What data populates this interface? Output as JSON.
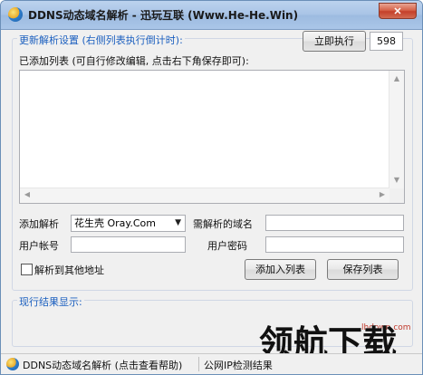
{
  "window": {
    "title": "DDNS动态域名解析 - 迅玩互联 (Www.He-He.Win)",
    "close_glyph": "✕"
  },
  "update_group": {
    "label": "更新解析设置 (右侧列表执行倒计时):",
    "execute_button": "立即执行",
    "countdown": "598",
    "list_caption": "已添加列表 (可自行修改编辑, 点击右下角保存即可):"
  },
  "form": {
    "add_label": "添加解析",
    "provider_selected": "花生壳 Oray.Com",
    "domain_label": "需解析的域名",
    "domain_value": "",
    "account_label": "用户帐号",
    "account_value": "",
    "password_label": "用户密码",
    "password_value": "",
    "other_address_label": "解析到其他地址",
    "add_to_list_button": "添加入列表",
    "save_list_button": "保存列表"
  },
  "result_group": {
    "label": "现行结果显示:"
  },
  "statusbar": {
    "left_text": "DDNS动态域名解析 (点击查看帮助)",
    "right_text": "公网IP检测结果"
  },
  "watermark": {
    "site": "lhdown.com",
    "brand": "领航下载"
  },
  "colors": {
    "group_label": "#1b5fbf",
    "titlebar": "#a9c4e6",
    "close_button": "#c4402a"
  }
}
